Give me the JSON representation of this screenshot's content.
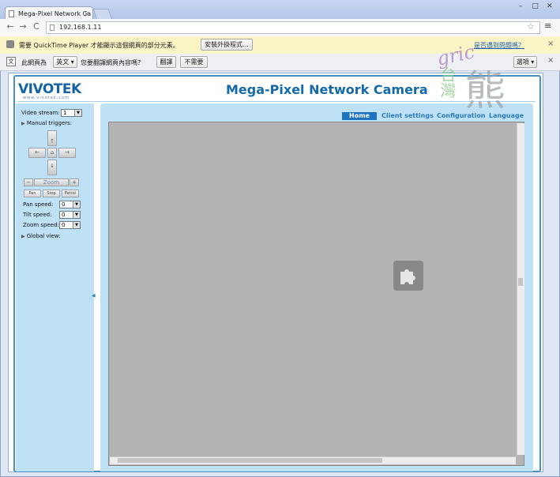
{
  "browser": {
    "tab_title": "Mega-Pixel Network Ca",
    "tab_close": "×",
    "url": "192.168.1.11",
    "back": "←",
    "forward": "→",
    "reload": "C",
    "star": "☆",
    "menu": "≡",
    "minimize": "–",
    "maximize": "□",
    "close": "✕"
  },
  "infobar": {
    "message": "需要 QuickTime Player 才能顯示這個網頁的部分元素。",
    "install_button": "安裝外掛程式...",
    "help_link": "是否遇到問題嗎？",
    "close": "×"
  },
  "translate": {
    "prefix": "此網頁為",
    "language": "英文",
    "question": "您要翻譯網頁內容嗎？",
    "translate_button": "翻譯",
    "nope_button": "不需要",
    "options_button": "選項"
  },
  "camera": {
    "logo": "VIVOTEK",
    "logo_sub": "www.vivotek.com",
    "title": "Mega-Pixel Network Camera",
    "nav": [
      "Home",
      "Client settings",
      "Configuration",
      "Language"
    ],
    "video_stream_label": "Video stream:",
    "video_stream_value": "1",
    "manual_triggers": "Manual triggers:",
    "zoom_label": "Zoom",
    "zoom_minus": "−",
    "zoom_plus": "+",
    "pan_btn": "Pan",
    "stop_btn": "Stop",
    "patrol_btn": "Patrol",
    "pan_speed_label": "Pan speed:",
    "pan_speed_value": "0",
    "tilt_speed_label": "Tilt speed:",
    "tilt_speed_value": "0",
    "zoom_speed_label": "Zoom speed:",
    "zoom_speed_value": "0",
    "global_view": "Global view:"
  },
  "watermark": {
    "script": "gric",
    "tw": "台灣",
    "bear": "熊"
  },
  "colors": {
    "brand_blue": "#1469a8",
    "panel_bg": "#bfe1f6",
    "active_tab": "#1f72c0",
    "video_bg": "#b4b4b4"
  }
}
